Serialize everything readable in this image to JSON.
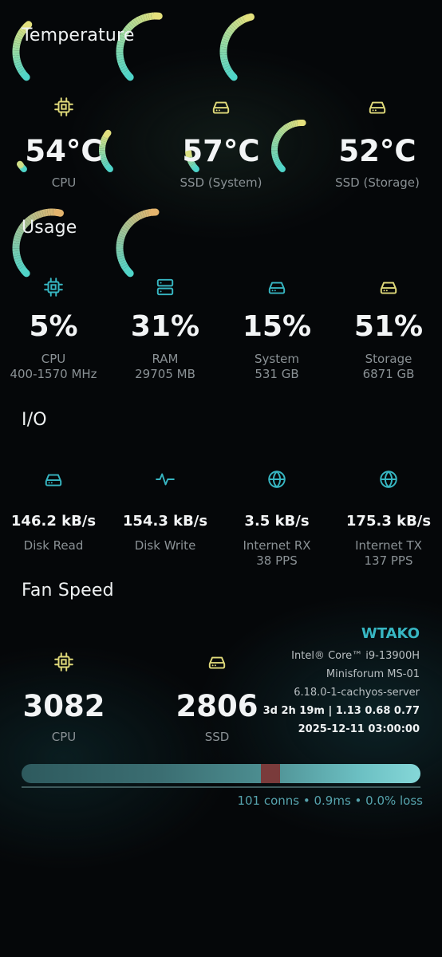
{
  "sections": {
    "temperature": "Temperature",
    "usage": "Usage",
    "io": "I/O",
    "fan": "Fan Speed"
  },
  "temperature": [
    {
      "value": "54°C",
      "label": "CPU",
      "icon": "cpu-icon",
      "level": 0.35
    },
    {
      "value": "57°C",
      "label": "SSD (System)",
      "icon": "drive-icon",
      "level": 0.52
    },
    {
      "value": "52°C",
      "label": "SSD (Storage)",
      "icon": "drive-icon",
      "level": 0.45
    }
  ],
  "usage": [
    {
      "value": "5%",
      "label": "CPU",
      "sub": "400-1570 MHz",
      "icon": "cpu-icon",
      "level": 0.05
    },
    {
      "value": "31%",
      "label": "RAM",
      "sub": "29705 MB",
      "icon": "server-icon",
      "level": 0.31
    },
    {
      "value": "15%",
      "label": "System",
      "sub": "531 GB",
      "icon": "drive-icon",
      "level": 0.15
    },
    {
      "value": "51%",
      "label": "Storage",
      "sub": "6871 GB",
      "icon": "drive-icon",
      "level": 0.51
    }
  ],
  "io": [
    {
      "value": "146.2 kB/s",
      "label": "Disk Read",
      "sub": "",
      "icon": "drive-icon"
    },
    {
      "value": "154.3 kB/s",
      "label": "Disk Write",
      "sub": "",
      "icon": "activity-icon"
    },
    {
      "value": "3.5 kB/s",
      "label": "Internet RX",
      "sub": "38 PPS",
      "icon": "globe-icon"
    },
    {
      "value": "175.3 kB/s",
      "label": "Internet TX",
      "sub": "137 PPS",
      "icon": "globe-icon"
    }
  ],
  "fan": [
    {
      "value": "3082",
      "label": "CPU",
      "icon": "cpu-icon",
      "level": 0.55
    },
    {
      "value": "2806",
      "label": "SSD",
      "icon": "drive-icon",
      "level": 0.5
    }
  ],
  "system": {
    "hostname": "WTAKO",
    "cpu_model": "Intel® Core™ i9-13900H",
    "machine": "Minisforum MS-01",
    "kernel": "6.18.0-1-cachyos-server",
    "uptime_load": "3d 2h 19m | 1.13 0.68 0.77",
    "datetime": "2025-12-11 03:00:00"
  },
  "network": {
    "stats": "101 conns • 0.9ms • 0.0% loss"
  },
  "colors": {
    "accent": "#37b6c2",
    "gauge_start": "#4fd4c9",
    "gauge_end": "#e8e07a",
    "fan_end": "#e8b36a",
    "marker": "#7a3b3b"
  }
}
